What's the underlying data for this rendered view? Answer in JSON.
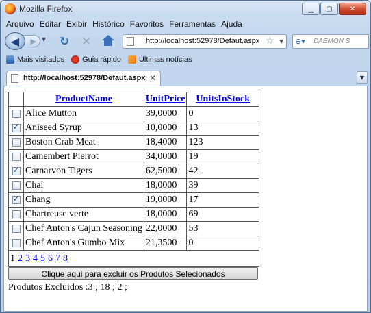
{
  "window": {
    "title": "Mozilla Firefox"
  },
  "menu": [
    "Arquivo",
    "Editar",
    "Exibir",
    "Histórico",
    "Favoritos",
    "Ferramentas",
    "Ajuda"
  ],
  "nav": {
    "url": "http://localhost:52978/Defaut.aspx",
    "search_placeholder": "DAEMON S"
  },
  "bookmarks": [
    "Mais visitados",
    "Guia rápido",
    "Últimas notícias"
  ],
  "tab": {
    "label": "http://localhost:52978/Defaut.aspx"
  },
  "grid": {
    "headers": [
      "ProductName",
      "UnitPrice",
      "UnitsInStock"
    ],
    "rows": [
      {
        "checked": false,
        "name": "Alice Mutton",
        "price": "39,0000",
        "stock": "0"
      },
      {
        "checked": true,
        "name": "Aniseed Syrup",
        "price": "10,0000",
        "stock": "13"
      },
      {
        "checked": false,
        "name": "Boston Crab Meat",
        "price": "18,4000",
        "stock": "123"
      },
      {
        "checked": false,
        "name": "Camembert Pierrot",
        "price": "34,0000",
        "stock": "19"
      },
      {
        "checked": true,
        "name": "Carnarvon Tigers",
        "price": "62,5000",
        "stock": "42"
      },
      {
        "checked": false,
        "name": "Chai",
        "price": "18,0000",
        "stock": "39"
      },
      {
        "checked": true,
        "name": "Chang",
        "price": "19,0000",
        "stock": "17"
      },
      {
        "checked": false,
        "name": "Chartreuse verte",
        "price": "18,0000",
        "stock": "69"
      },
      {
        "checked": false,
        "name": "Chef Anton's Cajun Seasoning",
        "price": "22,0000",
        "stock": "53"
      },
      {
        "checked": false,
        "name": "Chef Anton's Gumbo Mix",
        "price": "21,3500",
        "stock": "0"
      }
    ],
    "pager": {
      "current": "1",
      "pages": [
        "2",
        "3",
        "4",
        "5",
        "6",
        "7",
        "8"
      ]
    }
  },
  "delete_button": "Clique aqui para excluir os Produtos Selecionados",
  "status": "Produtos Excluidos :3 ; 18 ; 2 ;"
}
